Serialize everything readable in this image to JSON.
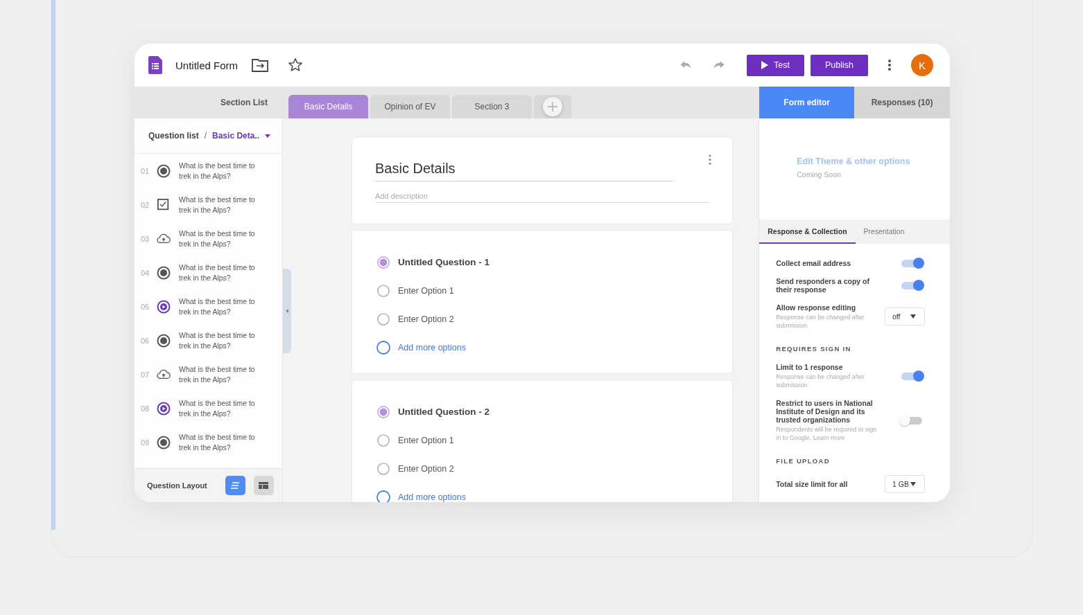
{
  "header": {
    "title": "Untitled Form",
    "buttons": [
      {
        "kind": "test",
        "label": "Test"
      },
      {
        "kind": "publish",
        "label": "Publish"
      }
    ],
    "avatar": "K"
  },
  "section_list_label": "Section List",
  "section_tabs": [
    {
      "label": "Basic Details",
      "selected": true
    },
    {
      "label": "Opinion of EV",
      "selected": false
    },
    {
      "label": "Section 3",
      "selected": false
    }
  ],
  "panel_tabs": [
    {
      "label": "Form editor",
      "selected": true
    },
    {
      "label": "Responses (10)",
      "selected": false
    }
  ],
  "question_list": {
    "title": "Question list",
    "separator": "/",
    "section": "Basic Deta..",
    "items": [
      {
        "number": "01",
        "kind": "radio",
        "text": "What is the best time to trek in the Alps?"
      },
      {
        "number": "02",
        "kind": "checkbox",
        "text": "What is the best time to trek in the Alps?"
      },
      {
        "number": "03",
        "kind": "upload",
        "text": "What is the best time to trek in the Alps?"
      },
      {
        "number": "04",
        "kind": "radio",
        "text": "What is the best time to trek in the Alps?"
      },
      {
        "number": "05",
        "kind": "video",
        "text": "What is the best time to trek in the Alps?"
      },
      {
        "number": "06",
        "kind": "radio",
        "text": "What is the best time to trek in the Alps?"
      },
      {
        "number": "07",
        "kind": "upload",
        "text": "What is the best time to trek in the Alps?"
      },
      {
        "number": "08",
        "kind": "video",
        "text": "What is the best time to trek in the Alps?"
      },
      {
        "number": "09",
        "kind": "radio",
        "text": "What is the best time to trek in the Alps?"
      }
    ]
  },
  "layout_bar": {
    "label": "Question Layout",
    "options": [
      {
        "kind": "list",
        "selected": true
      },
      {
        "kind": "card",
        "selected": false
      }
    ]
  },
  "section_card": {
    "title": "Basic Details",
    "description_placeholder": "Add description"
  },
  "questions": [
    {
      "title": "Untitled Question - 1",
      "options": [
        "Enter Option 1",
        "Enter Option 2"
      ],
      "add_label": "Add more options"
    },
    {
      "title": "Untitled Question - 2",
      "options": [
        "Enter Option 1",
        "Enter Option 2"
      ],
      "add_label": "Add more options"
    }
  ],
  "theme": {
    "link": "Edit Theme & other options",
    "note": "Coming Soon"
  },
  "settings_tabs": [
    {
      "label": "Response & Collection",
      "selected": true
    },
    {
      "label": "Presentation",
      "selected": false
    }
  ],
  "settings": [
    {
      "kind": "toggle",
      "label": "Collect email address",
      "on": true
    },
    {
      "kind": "toggle",
      "label": "Send responders a copy of their response",
      "on": true
    },
    {
      "kind": "select",
      "label": "Allow response editing",
      "hint": "Response can be changed after submission",
      "value": "off"
    },
    {
      "kind": "heading",
      "label": "REQUIRES SIGN IN"
    },
    {
      "kind": "toggle",
      "label": "Limit to 1 response",
      "hint": "Response can be changed after submission",
      "on": true
    },
    {
      "kind": "toggle",
      "label": "Restrict to users in National Institute of Design and its trusted organizations",
      "hint": "Respondents will be required to sign in to Google. Learn more",
      "on": false
    },
    {
      "kind": "heading",
      "label": "FILE UPLOAD"
    },
    {
      "kind": "select",
      "label": "Total size limit for all",
      "value": "1 GB"
    }
  ]
}
